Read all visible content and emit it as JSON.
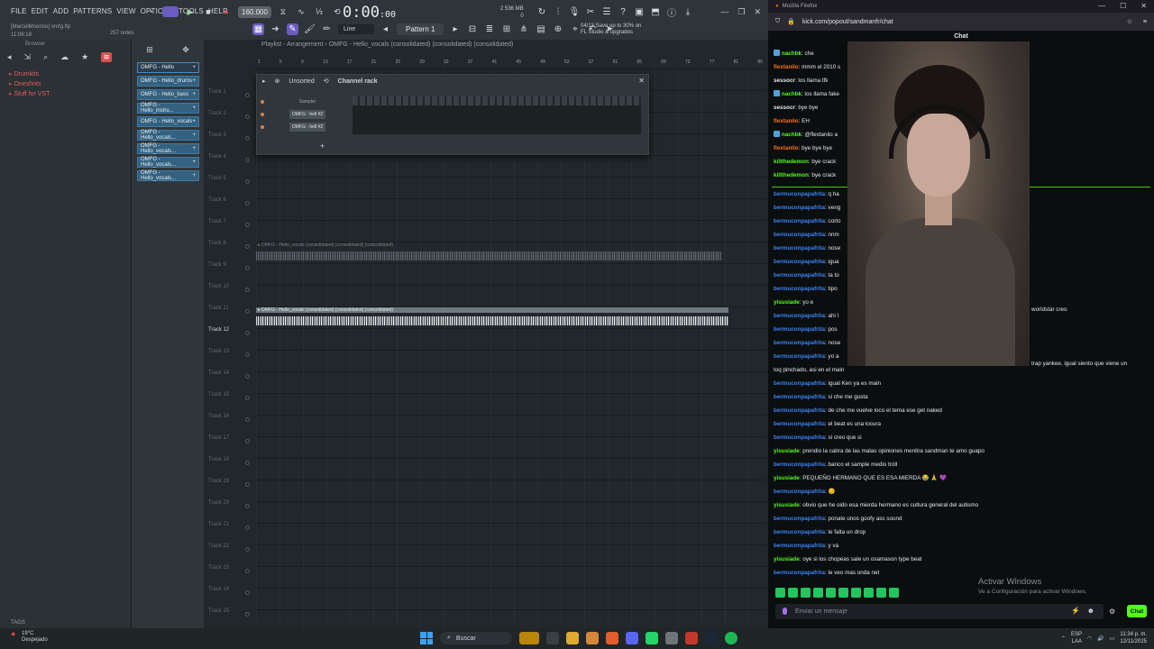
{
  "fl": {
    "menu": [
      "FILE",
      "EDIT",
      "ADD",
      "PATTERNS",
      "VIEW",
      "OPTIONS",
      "TOOLS",
      "HELP"
    ],
    "user_line": "[MarcelMoonno] omfg.flp",
    "time_line": "11:06:18",
    "notes": "257 notes",
    "tempo": "160.000",
    "time_display_main": "0:00",
    "time_display_sub": "00",
    "cpu_top": "2     536 MB",
    "cpu_bottom": "0",
    "line_mode": "Line",
    "pattern": "Pattern 1",
    "news_line1": "04/13  Save up to 30% on",
    "news_line2": "FL Studio & upgrades",
    "browser_title": "Browser",
    "browser_items": [
      "Drumkits",
      "Oneshots",
      "Stuff for VST"
    ],
    "tags": "TAGS",
    "patterns": [
      "OMFG - Hello",
      "OMFG - Hello_drums",
      "OMFG - Hello_bass",
      "OMFG - Hello_instru...",
      "OMFG - Hello_vocals",
      "OMFG - Hello_vocals...",
      "OMFG - Hello_vocals...",
      "OMFG - Hello_vocals...",
      "OMFG - Hello_vocals..."
    ],
    "playlist_title": "Playlist - Arrangement › OMFG - Hello_vocals (consolidated) (consolidated) (consolidated)",
    "ruler": [
      "1",
      "5",
      "9",
      "13",
      "17",
      "21",
      "25",
      "29",
      "33",
      "37",
      "41",
      "45",
      "49",
      "53",
      "57",
      "61",
      "65",
      "69",
      "73",
      "77",
      "81",
      "85"
    ],
    "tracks": [
      "Track 1",
      "Track 2",
      "Track 3",
      "Track 4",
      "Track 5",
      "Track 6",
      "Track 7",
      "Track 8",
      "Track 9",
      "Track 10",
      "Track 11",
      "Track 12",
      "Track 13",
      "Track 14",
      "Track 15",
      "Track 16",
      "Track 17",
      "Track 18",
      "Track 19",
      "Track 20",
      "Track 21",
      "Track 22",
      "Track 23",
      "Track 24",
      "Track 25",
      "Track 26"
    ],
    "active_track": "Track 12",
    "clip_dim": "▸ OMFG - Hello_vocals (consolidated) (consolidated) (consolidated)",
    "clip_selected": "▸ OMFG - Hello_vocals (consolidated) (consolidated) (consolidated)",
    "channel_rack": {
      "filter": "Unsorted",
      "title": "Channel rack",
      "channels": [
        "Sampler",
        "OMFG - hell #2",
        "OMFG - hell #2"
      ]
    }
  },
  "firefox": {
    "window_title": "Mozilla Firefox",
    "url": "kick.com/popout/sandmanfr/chat",
    "chat_heading": "Chat",
    "messages_top": [
      {
        "user": "nachbk",
        "text": "che",
        "color": "#53fc18",
        "badge": true
      },
      {
        "user": "flextanilo",
        "text": "mmm el 2010 s",
        "color": "#f97316",
        "badge": false
      },
      {
        "user": "sessocr",
        "text": "los llama tfk",
        "color": "#e6e8ea",
        "badge": false
      },
      {
        "user": "nachbk",
        "text": "los llama fake",
        "color": "#53fc18",
        "badge": true
      },
      {
        "user": "sessocr",
        "text": "bye bye",
        "color": "#e6e8ea",
        "badge": false
      },
      {
        "user": "flextanilo",
        "text": "EH",
        "color": "#f97316",
        "badge": false
      },
      {
        "user": "nachbk",
        "text": "@flextanilo a",
        "color": "#53fc18",
        "badge": true
      },
      {
        "user": "flextanilo",
        "text": "bye bye bye",
        "color": "#f97316",
        "badge": false
      },
      {
        "user": "killthedemon",
        "text": "bye crack",
        "color": "#53fc18",
        "badge": false
      },
      {
        "user": "killthedemon",
        "text": "bye crack",
        "color": "#53fc18",
        "badge": false
      }
    ],
    "messages_bottom": [
      {
        "user": "bermuconpapafrita",
        "text": "q ha",
        "color": "#3b82f6"
      },
      {
        "user": "bermuconpapafrita",
        "text": "veng",
        "color": "#3b82f6"
      },
      {
        "user": "bermuconpapafrita",
        "text": "corto",
        "color": "#3b82f6"
      },
      {
        "user": "bermuconpapafrita",
        "text": "nnm",
        "color": "#3b82f6"
      },
      {
        "user": "bermuconpapafrita",
        "text": "nose",
        "color": "#3b82f6"
      },
      {
        "user": "bermuconpapafrita",
        "text": "igua",
        "color": "#3b82f6"
      },
      {
        "user": "bermuconpapafrita",
        "text": "ta to",
        "color": "#3b82f6"
      },
      {
        "user": "bermuconpapafrita",
        "text": "tipo",
        "color": "#3b82f6"
      },
      {
        "user": "yisusiade",
        "text": "yo e",
        "color": "#53fc18"
      },
      {
        "user": "bermuconpapafrita",
        "text": "ahi l",
        "color": "#3b82f6"
      },
      {
        "user": "bermuconpapafrita",
        "text": "pos",
        "color": "#3b82f6"
      },
      {
        "user": "bermuconpapafrita",
        "text": "nose",
        "color": "#3b82f6"
      },
      {
        "user": "bermuconpapafrita",
        "text": "yo a",
        "color": "#3b82f6"
      },
      {
        "user": "",
        "text": "toq pinchado, asi en el main",
        "color": "#3b82f6"
      },
      {
        "user": "bermuconpapafrita",
        "text": "igual Ken ya es main",
        "color": "#3b82f6"
      },
      {
        "user": "bermuconpapafrita",
        "text": "si che me gusta",
        "color": "#3b82f6"
      },
      {
        "user": "bermuconpapafrita",
        "text": "de che me vuelve loco el tema ese get naked",
        "color": "#3b82f6"
      },
      {
        "user": "bermuconpapafrita",
        "text": "el beat es una locura",
        "color": "#3b82f6"
      },
      {
        "user": "bermuconpapafrita",
        "text": "si creo que si",
        "color": "#3b82f6"
      },
      {
        "user": "yisusiade",
        "text": "prendio la cabra de las malas opiniones mentira sandman te amo guapo",
        "color": "#53fc18"
      },
      {
        "user": "bermuconpapafrita",
        "text": "banco el sample medio troll",
        "color": "#3b82f6"
      },
      {
        "user": "yisusiade",
        "text": "PEQUEÑO HERMANO QUE ES ESA MIERDA 😂 🙏 💜",
        "color": "#53fc18"
      },
      {
        "user": "bermuconpapafrita",
        "text": "😊",
        "color": "#3b82f6"
      },
      {
        "user": "yisusiade",
        "text": "obvio que he oido esa mierda hermano es cultura general del autismo",
        "color": "#53fc18"
      },
      {
        "user": "bermuconpapafrita",
        "text": "ponale unos goofy ass sound",
        "color": "#3b82f6"
      },
      {
        "user": "bermuconpapafrita",
        "text": "le falta un drop",
        "color": "#3b82f6"
      },
      {
        "user": "bermuconpapafrita",
        "text": "y va",
        "color": "#3b82f6"
      },
      {
        "user": "yisusiade",
        "text": "oye si los chopeas sale un osamason type beat",
        "color": "#53fc18"
      },
      {
        "user": "bermuconpapafrita",
        "text": "le veo mas onda net",
        "color": "#3b82f6"
      }
    ],
    "side_text_1": "worldstar creo",
    "side_text_2": "trap yankee, igual siento que viene un",
    "activate_title": "Activar Windows",
    "activate_sub": "Ve a Configuración para activar Windows.",
    "input_placeholder": "Enviar un mensaje",
    "chat_button": "Chat"
  },
  "taskbar": {
    "temp": "19°C",
    "weather": "Despejado",
    "search": "Buscar",
    "lang1": "ESP",
    "lang2": "LAA",
    "time": "11:34 p. m.",
    "date": "12/11/2025"
  }
}
